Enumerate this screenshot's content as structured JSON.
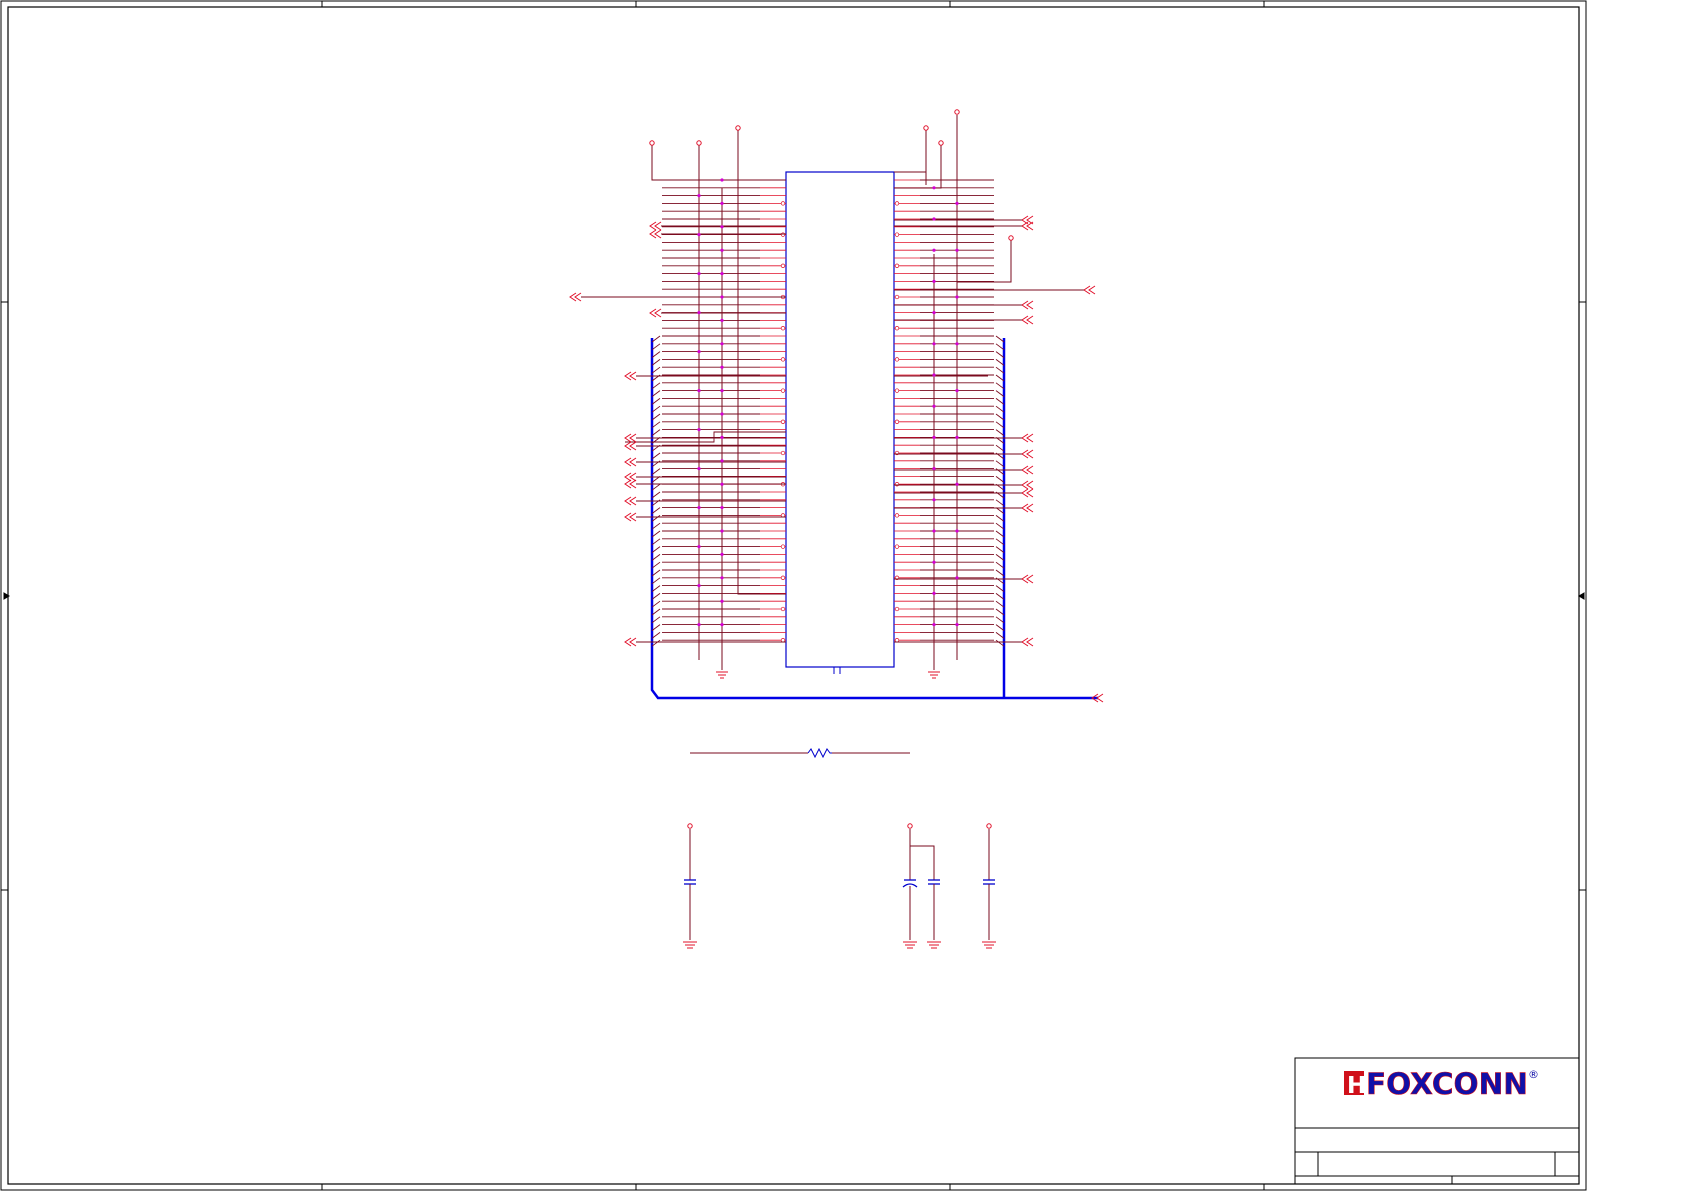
{
  "title_block": {
    "company_logo_text": "FOXCONN",
    "logo_mark_text": "H",
    "registered_mark": "®"
  },
  "colors": {
    "wire": "#7a0a1e",
    "pin": "#e0102a",
    "body": "#0000cc",
    "bus": "#0000e6",
    "junction": "#d500d5",
    "border": "#000000",
    "logo_fill": "#1010a8",
    "logo_accent": "#d0101a"
  },
  "icons": {
    "off_page_connector": "double-chevron-left-icon",
    "ground": "ground-symbol-icon",
    "power": "power-port-circle-icon"
  }
}
